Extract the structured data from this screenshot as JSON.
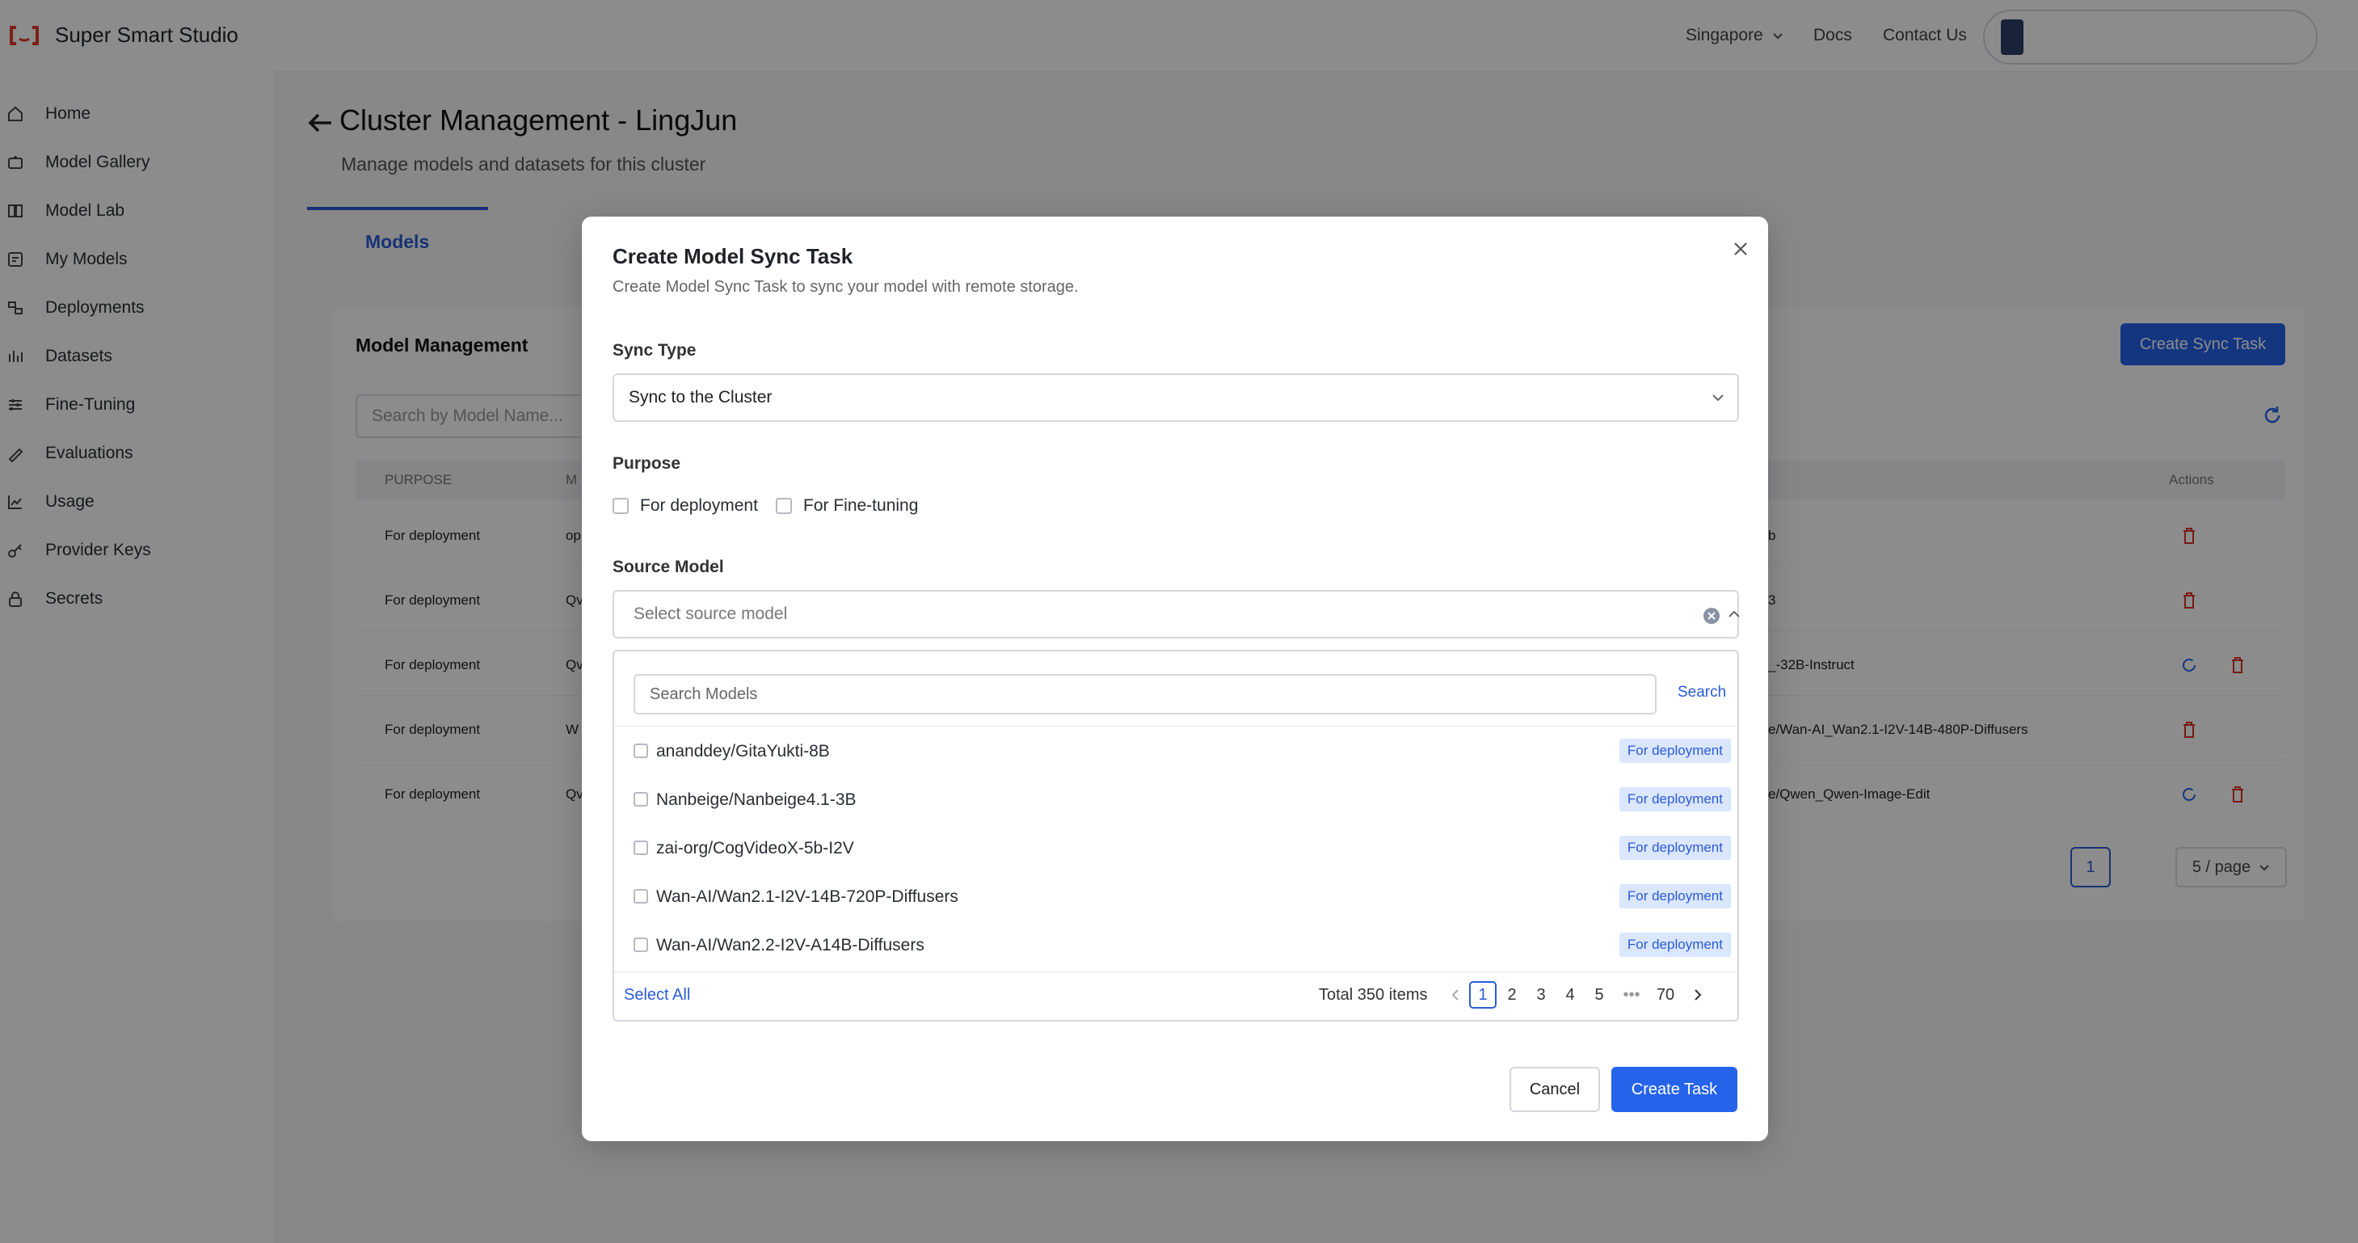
{
  "app": {
    "name": "Super Smart Studio"
  },
  "topnav": {
    "region": "Singapore",
    "docs": "Docs",
    "contact": "Contact Us"
  },
  "sidebar": {
    "items": [
      {
        "label": "Home",
        "icon": "home-icon"
      },
      {
        "label": "Model Gallery",
        "icon": "model-gallery-icon"
      },
      {
        "label": "Model Lab",
        "icon": "model-lab-icon"
      },
      {
        "label": "My Models",
        "icon": "my-models-icon"
      },
      {
        "label": "Deployments",
        "icon": "deployments-icon"
      },
      {
        "label": "Datasets",
        "icon": "datasets-icon"
      },
      {
        "label": "Fine-Tuning",
        "icon": "fine-tuning-icon"
      },
      {
        "label": "Evaluations",
        "icon": "evaluations-icon"
      },
      {
        "label": "Usage",
        "icon": "usage-icon"
      },
      {
        "label": "Provider Keys",
        "icon": "provider-keys-icon"
      },
      {
        "label": "Secrets",
        "icon": "secrets-icon"
      }
    ]
  },
  "page": {
    "title": "Cluster Management - LingJun",
    "subtitle": "Manage models and datasets for this cluster",
    "tab": "Models"
  },
  "management": {
    "title": "Model Management",
    "search_placeholder": "Search by Model Name...",
    "create_sync_task": "Create Sync Task",
    "columns": {
      "purpose": "PURPOSE",
      "model": "M",
      "actions": "Actions"
    },
    "rows": [
      {
        "purpose": "For deployment",
        "model": "op",
        "path": "b"
      },
      {
        "purpose": "For deployment",
        "model": "Qv",
        "path": "3"
      },
      {
        "purpose": "For deployment",
        "model": "Qv",
        "path": "_-32B-Instruct"
      },
      {
        "purpose": "For deployment",
        "model": "W",
        "path": "e/Wan-AI_Wan2.1-I2V-14B-480P-Diffusers"
      },
      {
        "purpose": "For deployment",
        "model": "Qv",
        "path": "e/Qwen_Qwen-Image-Edit"
      }
    ],
    "page": "1",
    "per_page": "5 / page"
  },
  "modal": {
    "title": "Create Model Sync Task",
    "description": "Create Model Sync Task to sync your model with remote storage.",
    "sync_type_label": "Sync Type",
    "sync_type_value": "Sync to the Cluster",
    "purpose_label": "Purpose",
    "purpose_options": [
      "For deployment",
      "For Fine-tuning"
    ],
    "source_model_label": "Source Model",
    "source_model_placeholder": "Select source model",
    "dropdown": {
      "search_placeholder": "Search Models",
      "search_button": "Search",
      "models": [
        {
          "name": "ananddey/GitaYukti-8B",
          "tag": "For deployment"
        },
        {
          "name": "Nanbeige/Nanbeige4.1-3B",
          "tag": "For deployment"
        },
        {
          "name": "zai-org/CogVideoX-5b-I2V",
          "tag": "For deployment"
        },
        {
          "name": "Wan-AI/Wan2.1-I2V-14B-720P-Diffusers",
          "tag": "For deployment"
        },
        {
          "name": "Wan-AI/Wan2.2-I2V-A14B-Diffusers",
          "tag": "For deployment"
        }
      ],
      "select_all": "Select All",
      "total": "Total 350 items",
      "pages": [
        "1",
        "2",
        "3",
        "4",
        "5",
        "•••",
        "70"
      ],
      "current_page": "1"
    },
    "cancel": "Cancel",
    "create": "Create Task"
  },
  "colors": {
    "accent": "#2563eb",
    "tag_bg": "#dbe6ff",
    "danger": "#d93025",
    "logo": "#e23b2e"
  }
}
